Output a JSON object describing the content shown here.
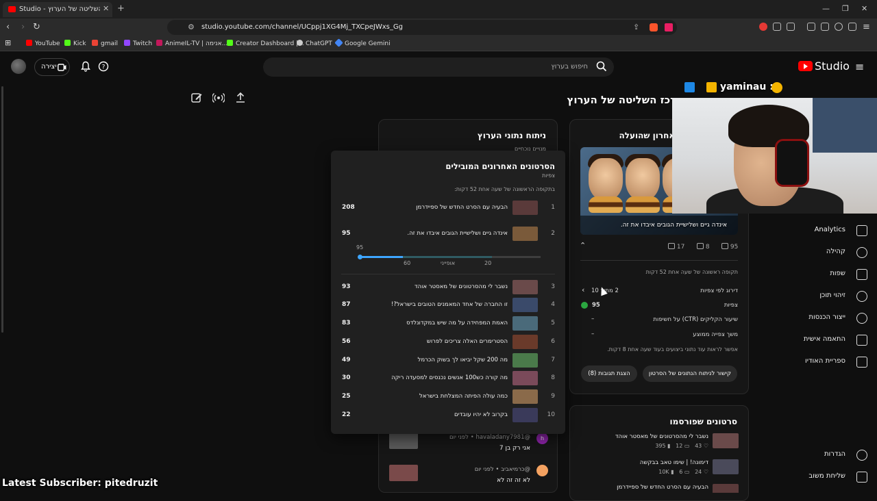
{
  "browser": {
    "tab_title": "Studio - מרכז השליטה של הערוץ",
    "new_tab": "+",
    "url": "studio.youtube.com/channel/UCppj1XG4Mj_TXCpeJWxs_Gg",
    "bookmarks": [
      {
        "label": "YouTube",
        "color": "#ff0000"
      },
      {
        "label": "Kick",
        "color": "#53fc18"
      },
      {
        "label": "gmail",
        "color": "#ea4335"
      },
      {
        "label": "Twitch",
        "color": "#9146ff"
      },
      {
        "label": "AnimeIL-TV | אנימה...",
        "color": "#c2185b"
      },
      {
        "label": "Creator Dashboard |...",
        "color": "#53fc18"
      },
      {
        "label": "ChatGPT",
        "color": "#cccccc"
      },
      {
        "label": "Google Gemini",
        "color": "#4285f4"
      }
    ]
  },
  "header": {
    "logo": "Studio",
    "search_placeholder": "חיפוש בערוץ",
    "create_label": "יצירה"
  },
  "page": {
    "title": "מרכז השליטה של הערוץ"
  },
  "sidebar": {
    "items": [
      {
        "label": "Analytics",
        "icon": "analytics-icon"
      },
      {
        "label": "קהילה",
        "icon": "community-icon"
      },
      {
        "label": "שפות",
        "icon": "subtitles-icon"
      },
      {
        "label": "זיהוי תוכן",
        "icon": "copyright-icon"
      },
      {
        "label": "ייצור הכנסות",
        "icon": "monetization-icon"
      },
      {
        "label": "התאמה אישית",
        "icon": "customization-icon"
      },
      {
        "label": "ספריית האודיו",
        "icon": "audio-library-icon"
      }
    ],
    "bottom": [
      {
        "label": "הגדרות",
        "icon": "settings-icon"
      },
      {
        "label": "שליחת משוב",
        "icon": "feedback-icon"
      }
    ]
  },
  "analytics_card": {
    "title": "ניתוח נתוני הערוץ",
    "subtitle": "מנויים נוכחיים"
  },
  "popup": {
    "title": "הסרטונים האחרונים המובילים",
    "subtitle": "צפיות",
    "period": "בתקופה הראשונה של שעה אחת 52 דקות:",
    "spark": {
      "value": "95",
      "label_low": "60",
      "label_mid": "אופייני",
      "label_high": "20",
      "fill_fraction": 0.55
    },
    "rows": [
      {
        "rank": "1",
        "title": "הבעיה עם הסרט החדש של ספיידרמן",
        "views": "208",
        "color": "#5a3a3a"
      },
      {
        "rank": "2",
        "title": "אינדה גיים ושלישיית הגובים איבדו את זה.",
        "views": "95",
        "color": "#7a5a3a"
      },
      {
        "rank": "3",
        "title": "נשבר לי מהסרטונים של מאסטר אוהד",
        "views": "93",
        "color": "#6a4a4a"
      },
      {
        "rank": "4",
        "title": "זו החברה של אחד המאמנים הטובים בישראל?!",
        "views": "87",
        "color": "#3a4a6a"
      },
      {
        "rank": "5",
        "title": "האמת המפחידה על מה שיש במקדונלדס",
        "views": "83",
        "color": "#4a6a7a"
      },
      {
        "rank": "6",
        "title": "הסטרימרים האלה צריכים לפרוש",
        "views": "56",
        "color": "#6a3a2a"
      },
      {
        "rank": "7",
        "title": "מה 200 שקל יביאו לך בשוק הכרמל",
        "views": "49",
        "color": "#4a7a4a"
      },
      {
        "rank": "8",
        "title": "מה קורה כש100 אנשים נכנסים למסעדה ריקה",
        "views": "30",
        "color": "#7a4a5a"
      },
      {
        "rank": "9",
        "title": "כמה עולה הפיתה המצלחת בישראל",
        "views": "25",
        "color": "#8a6a4a"
      },
      {
        "rank": "10",
        "title": "בקרוב לא יהיו עובדים",
        "views": "22",
        "color": "#3a3a5a"
      }
    ]
  },
  "comments": [
    {
      "author": "@havaladany7981 • לפני יום",
      "text": "אני רק בן 7",
      "avatar": "h",
      "avatar_color": "#8e24aa",
      "thumb_color": "#5a5a5a"
    },
    {
      "author": "@כרמיאביב • לפני יום",
      "text": "לא זה זה לא",
      "avatar": "",
      "avatar_color": "#f4a261",
      "thumb_color": "#7a4a4a"
    }
  ],
  "latest_video": {
    "card_title": "ביצועי הסרטון האחרון שהועלה",
    "thumb_caption": "אינדה גיים ושלישיית הגובים איבדו את זה.",
    "views": "95",
    "comments": "8",
    "likes": "17",
    "period": "תקופה ראשונה של שעה אחת 52 דקות",
    "rows": [
      {
        "label": "דירוג לפי צפיות",
        "value": "2 מתוך 10"
      },
      {
        "label": "צפיות",
        "value": "95"
      },
      {
        "label": "שיעור הקליקים (CTR) על חשיפות",
        "value": "–"
      },
      {
        "label": "משך צפייה ממוצע",
        "value": "–"
      }
    ],
    "note": "אפשר לראות עוד נתוני ביצועים בעוד שעה אחת 8 דקות.",
    "btn_analytics": "קישור לניתוח הנתונים של הסרטון",
    "btn_comments": "הצגת תגובות (8)"
  },
  "published": {
    "title": "סרטונים שפורסמו",
    "rows": [
      {
        "title": "נשבר לי מהסרטונים של מאסטר אוהד",
        "views": "395",
        "comments": "12",
        "likes": "43",
        "color": "#6a4a4a"
      },
      {
        "title": "דימונה! | שימו טאב בבקשה",
        "views": "10K",
        "comments": "6",
        "likes": "24",
        "color": "#4a4a5a"
      },
      {
        "title": "הבעיה עם הסרט החדש של ספיידרמן",
        "views": "",
        "comments": "",
        "likes": "",
        "color": "#5a3a3a"
      }
    ]
  },
  "overlay": {
    "name": "yaminau :",
    "latest_sub": "Latest Subscriber: pitedruzit"
  }
}
